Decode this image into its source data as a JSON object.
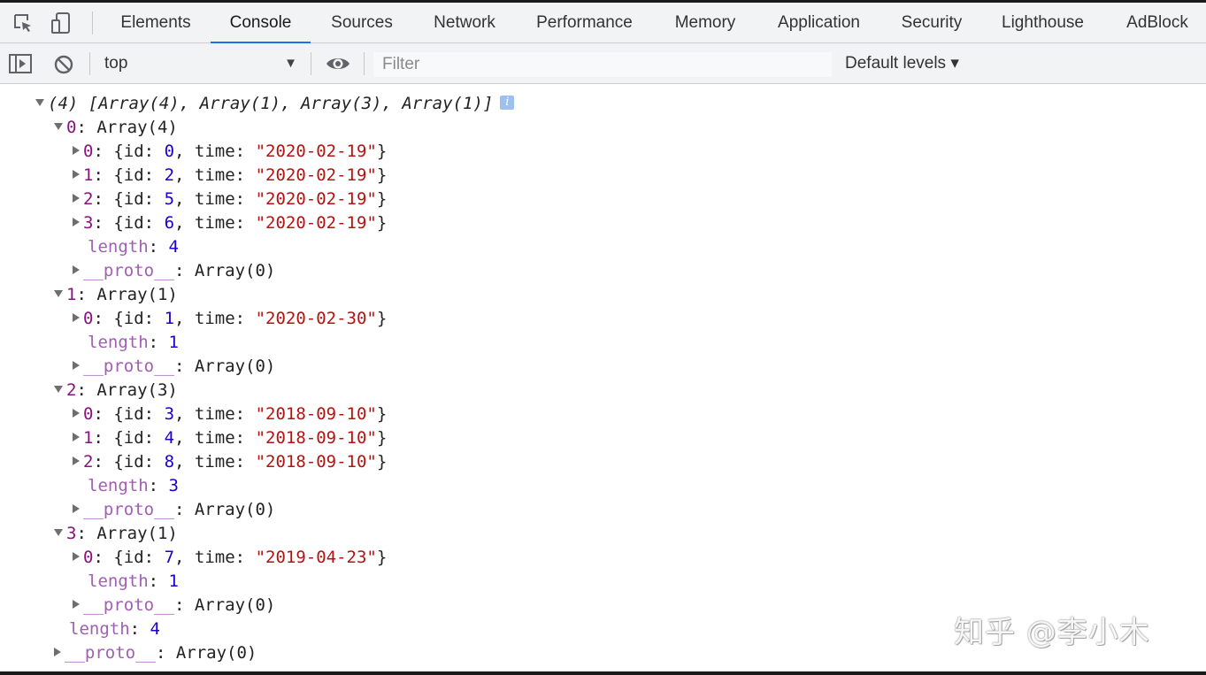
{
  "tabs": [
    {
      "label": "Elements"
    },
    {
      "label": "Console",
      "active": true
    },
    {
      "label": "Sources"
    },
    {
      "label": "Network"
    },
    {
      "label": "Performance"
    },
    {
      "label": "Memory"
    },
    {
      "label": "Application"
    },
    {
      "label": "Security"
    },
    {
      "label": "Lighthouse"
    },
    {
      "label": "AdBlock"
    }
  ],
  "toolbar": {
    "context": "top",
    "filter_placeholder": "Filter",
    "levels": "Default levels ▾"
  },
  "console": {
    "summary": "(4) [Array(4), Array(1), Array(3), Array(1)]",
    "info_icon": "i",
    "groups": [
      {
        "index": "0",
        "label": "Array(4)",
        "items": [
          {
            "index": "0",
            "id": "0",
            "time": "\"2020-02-19\""
          },
          {
            "index": "1",
            "id": "2",
            "time": "\"2020-02-19\""
          },
          {
            "index": "2",
            "id": "5",
            "time": "\"2020-02-19\""
          },
          {
            "index": "3",
            "id": "6",
            "time": "\"2020-02-19\""
          }
        ],
        "length": "4"
      },
      {
        "index": "1",
        "label": "Array(1)",
        "items": [
          {
            "index": "0",
            "id": "1",
            "time": "\"2020-02-30\""
          }
        ],
        "length": "1"
      },
      {
        "index": "2",
        "label": "Array(3)",
        "items": [
          {
            "index": "0",
            "id": "3",
            "time": "\"2018-09-10\""
          },
          {
            "index": "1",
            "id": "4",
            "time": "\"2018-09-10\""
          },
          {
            "index": "2",
            "id": "8",
            "time": "\"2018-09-10\""
          }
        ],
        "length": "3"
      },
      {
        "index": "3",
        "label": "Array(1)",
        "items": [
          {
            "index": "0",
            "id": "7",
            "time": "\"2019-04-23\""
          }
        ],
        "length": "1"
      }
    ],
    "length_key": "length",
    "proto_key": "__proto__",
    "proto_value": "Array(0)",
    "id_key": "id",
    "time_key": "time",
    "outer_length": "4"
  },
  "watermark": "知乎 @李小木",
  "colors": {
    "active_tab_indicator": "#1a73e8",
    "property_key": "#881280",
    "number": "#1c00cf",
    "string": "#b31412"
  },
  "icons": [
    "inspect-element-icon",
    "device-toolbar-icon",
    "sidebar-toggle-icon",
    "clear-console-icon",
    "eye-icon",
    "info-icon"
  ]
}
